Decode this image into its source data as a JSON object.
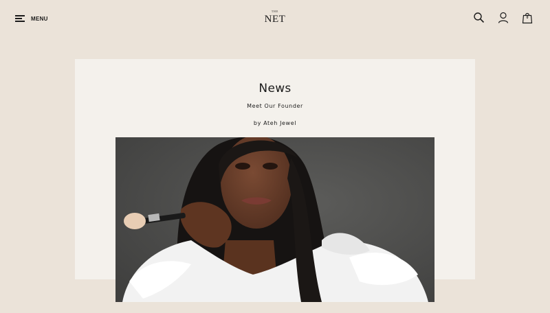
{
  "header": {
    "menu_label": "MENU",
    "logo_top": "THE",
    "logo_main": "NET",
    "bag_count": "0"
  },
  "icons": {
    "menu": "hamburger-icon",
    "search": "search-icon",
    "account": "user-icon",
    "bag": "shopping-bag-icon"
  },
  "article": {
    "section": "News",
    "title": "Meet Our Founder",
    "byline": "by Ateh Jewel"
  },
  "colors": {
    "page_background": "#ebe3d9",
    "card_background": "#f4f1ec",
    "text": "#1a1a1a",
    "photo_backdrop": "#4e4e4c"
  }
}
